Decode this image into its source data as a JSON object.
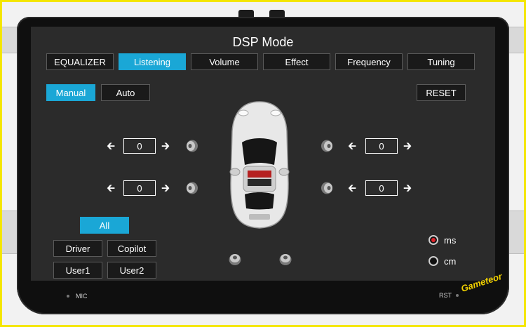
{
  "title": "DSP Mode",
  "tabs": [
    {
      "label": "EQUALIZER",
      "active": false
    },
    {
      "label": "Listening",
      "active": true
    },
    {
      "label": "Volume",
      "active": false
    },
    {
      "label": "Effect",
      "active": false
    },
    {
      "label": "Frequency",
      "active": false
    },
    {
      "label": "Tuning",
      "active": false
    }
  ],
  "mode": {
    "manual_label": "Manual",
    "auto_label": "Auto",
    "selected": "Manual"
  },
  "reset_label": "RESET",
  "delays": {
    "front_left": "0",
    "front_right": "0",
    "rear_left": "0",
    "rear_right": "0"
  },
  "position": {
    "all_label": "All",
    "driver_label": "Driver",
    "copilot_label": "Copilot",
    "user1_label": "User1",
    "user2_label": "User2",
    "selected": "All"
  },
  "units": {
    "ms_label": "ms",
    "cm_label": "cm",
    "selected": "ms"
  },
  "bezel": {
    "mic_label": "MIC",
    "rst_label": "RST"
  },
  "watermark": "Gameteor",
  "colors": {
    "accent": "#1aa7d6",
    "selected_radio": "#e0242b",
    "frame": "#f4e600"
  },
  "icons": [
    "arrow-left-icon",
    "arrow-right-icon",
    "speaker-icon",
    "car-icon"
  ]
}
